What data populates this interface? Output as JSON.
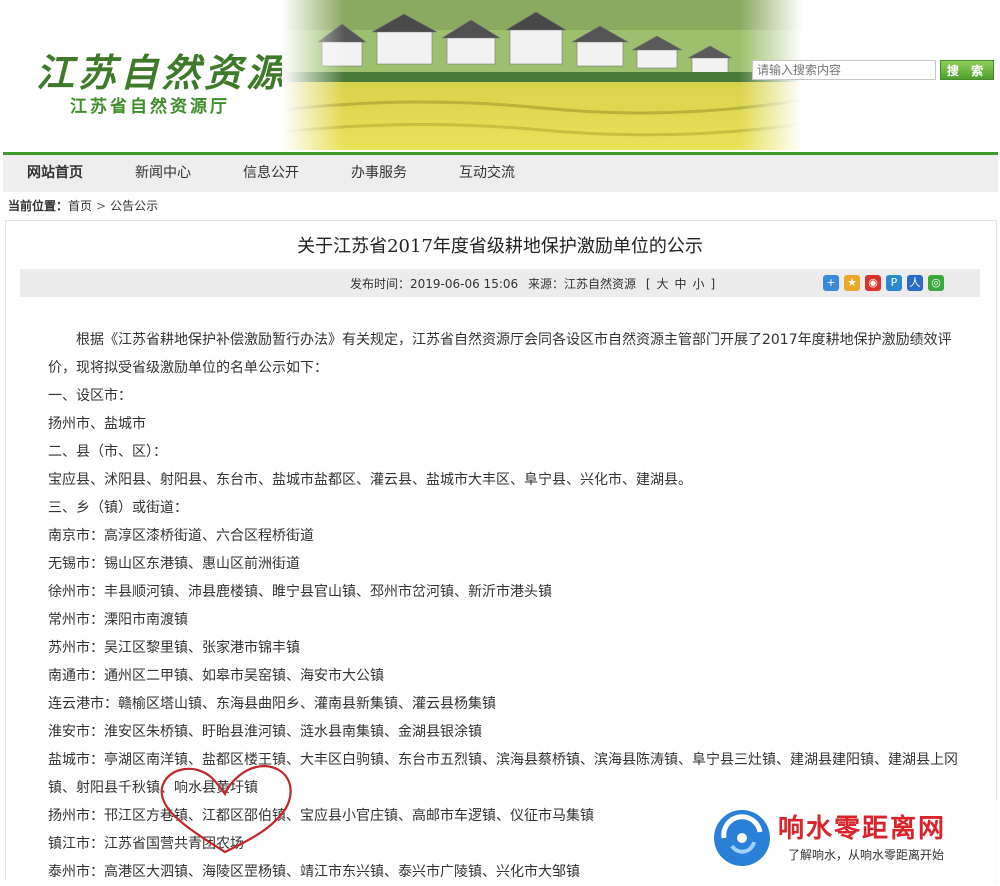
{
  "header": {
    "logo_text": "江苏自然资源",
    "logo_subtitle": "江苏省自然资源厅",
    "search_placeholder": "请输入搜索内容",
    "search_button": "搜 索"
  },
  "nav": {
    "items": [
      {
        "label": "网站首页"
      },
      {
        "label": "新闻中心"
      },
      {
        "label": "信息公开"
      },
      {
        "label": "办事服务"
      },
      {
        "label": "互动交流"
      }
    ]
  },
  "breadcrumb": {
    "prefix": "当前位置：",
    "home": "首页",
    "separator": ">",
    "current": "公告公示"
  },
  "article": {
    "title": "关于江苏省2017年度省级耕地保护激励单位的公示",
    "publish_time": "发布时间：2019-06-06 15:06",
    "source": "来源：江苏自然资源",
    "font_size_open": "[",
    "font_size_large": "大",
    "font_size_medium": "中",
    "font_size_small": "小",
    "font_size_close": "]",
    "intro": "根据《江苏省耕地保护补偿激励暂行办法》有关规定，江苏省自然资源厅会同各设区市自然资源主管部门开展了2017年度耕地保护激励绩效评价，现将拟受省级激励单位的名单公示如下：",
    "section1": "一、设区市：",
    "line1": "扬州市、盐城市",
    "section2": "二、县（市、区）：",
    "line2": "宝应县、沭阳县、射阳县、东台市、盐城市盐都区、灌云县、盐城市大丰区、阜宁县、兴化市、建湖县。",
    "section3": "三、乡（镇）或街道：",
    "towns": [
      "南京市：高淳区漆桥街道、六合区程桥街道",
      "无锡市：锡山区东港镇、惠山区前洲街道",
      "徐州市：丰县顺河镇、沛县鹿楼镇、睢宁县官山镇、邳州市岔河镇、新沂市港头镇",
      "常州市：溧阳市南渡镇",
      "苏州市：吴江区黎里镇、张家港市锦丰镇",
      "南通市：通州区二甲镇、如皋市吴窑镇、海安市大公镇",
      "连云港市：赣榆区塔山镇、东海县曲阳乡、灌南县新集镇、灌云县杨集镇",
      "淮安市：淮安区朱桥镇、盱眙县淮河镇、涟水县南集镇、金湖县银涂镇",
      "盐城市：亭湖区南洋镇、盐都区楼王镇、大丰区白驹镇、东台市五烈镇、滨海县蔡桥镇、滨海县陈涛镇、阜宁县三灶镇、建湖县建阳镇、建湖县上冈镇、射阳县千秋镇、响水县黄圩镇",
      "扬州市：邗江区方巷镇、江都区邵伯镇、宝应县小官庄镇、高邮市车逻镇、仪征市马集镇",
      "镇江市：江苏省国营共青团农场",
      "泰州市：高港区大泗镇、海陵区罡杨镇、靖江市东兴镇、泰兴市广陵镇、兴化市大邹镇"
    ]
  },
  "watermark": {
    "title": "响水零距离网",
    "subtitle": "了解响水，从响水零距离开始"
  },
  "colors": {
    "brand_green": "#3f9a2c",
    "heart_red": "#c0282e",
    "watermark_red": "#d8242a"
  }
}
